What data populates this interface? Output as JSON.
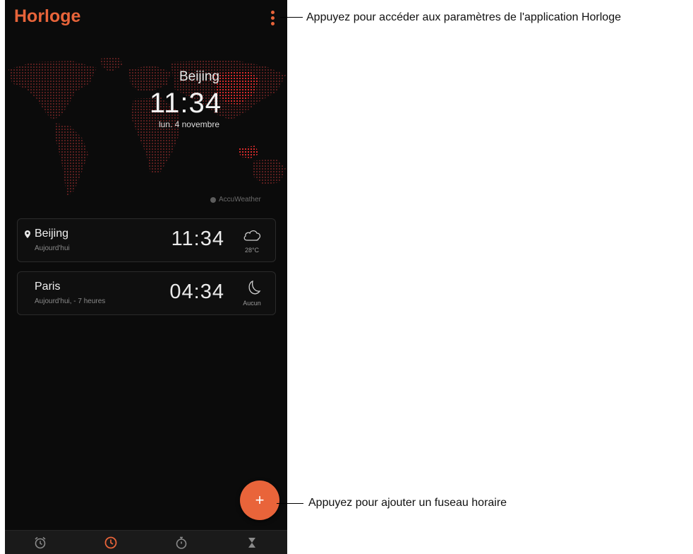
{
  "app": {
    "title": "Horloge"
  },
  "hero": {
    "city": "Beijing",
    "time": "11:34",
    "date": "lun. 4 novembre"
  },
  "provider": {
    "label": "AccuWeather"
  },
  "clocks": [
    {
      "city": "Beijing",
      "sub": "Aujourd'hui",
      "time": "11:34",
      "weather_icon": "cloud-icon",
      "weather_text": "28°C",
      "current_location": true
    },
    {
      "city": "Paris",
      "sub": "Aujourd'hui, - 7 heures",
      "time": "04:34",
      "weather_icon": "moon-icon",
      "weather_text": "Aucun",
      "current_location": false
    }
  ],
  "nav": {
    "tabs": [
      "alarm-icon",
      "world-clock-icon",
      "stopwatch-icon",
      "timer-icon"
    ],
    "active": "world-clock-icon"
  },
  "callouts": {
    "menu": "Appuyez pour accéder aux paramètres de l'application Horloge",
    "add": "Appuyez pour ajouter un fuseau horaire"
  },
  "colors": {
    "accent": "#e8643a",
    "background": "#0b0b0b",
    "map_dot": "#5a1e1e",
    "map_highlight": "#d42a2a"
  }
}
